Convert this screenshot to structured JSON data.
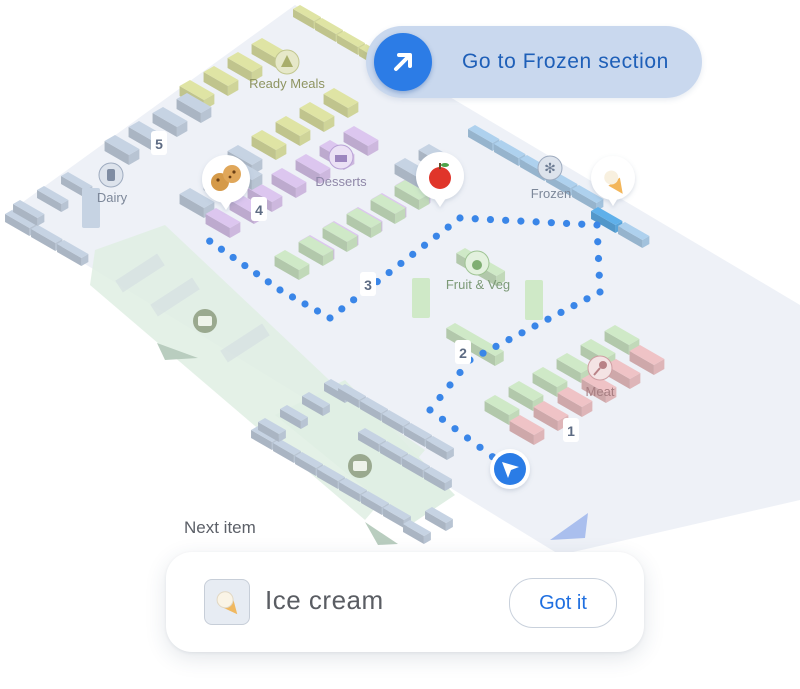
{
  "navigation": {
    "instruction": "Go to Frozen section",
    "accent": "#2c7ce6"
  },
  "map": {
    "sections": [
      {
        "name": "Ready Meals",
        "icon": "pizza-icon"
      },
      {
        "name": "Desserts",
        "icon": "cake-icon"
      },
      {
        "name": "Dairy",
        "icon": "milk-icon"
      },
      {
        "name": "Frozen",
        "icon": "snowflake-icon"
      },
      {
        "name": "Fruit & Veg",
        "icon": "apple-icon"
      },
      {
        "name": "Meat",
        "icon": "drumstick-icon"
      }
    ],
    "aisles": [
      "1",
      "2",
      "3",
      "4",
      "5"
    ],
    "markers": [
      "cookie-icon",
      "apple-icon",
      "ice-cream-icon"
    ],
    "colors": {
      "ready_meals": "#dfe4a4",
      "desserts": "#dcc6ef",
      "fruit_veg": "#cfe9c7",
      "meat": "#efc3c6",
      "frozen": "#aed1ee",
      "generic": "#c6d3e3",
      "route": "#3a86e8"
    }
  },
  "next_item": {
    "heading": "Next item",
    "name": "Ice cream",
    "icon": "ice-cream-icon",
    "action_label": "Got it"
  }
}
